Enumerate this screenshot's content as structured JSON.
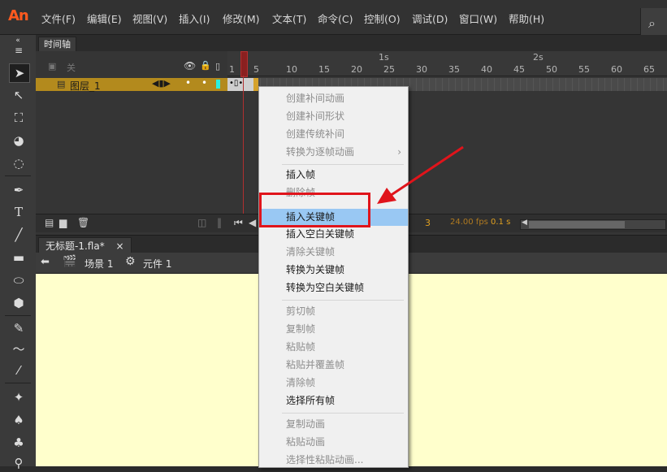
{
  "app": {
    "logo": "An"
  },
  "menubar": {
    "items": [
      "文件(F)",
      "编辑(E)",
      "视图(V)",
      "插入(I)",
      "修改(M)",
      "文本(T)",
      "命令(C)",
      "控制(O)",
      "调试(D)",
      "窗口(W)",
      "帮助(H)"
    ]
  },
  "timeline": {
    "tab_label": "时间轴",
    "header_label": "关",
    "layer_name": "图层_1",
    "ruler_ticks": [
      "1",
      "5",
      "10",
      "15",
      "20",
      "25",
      "30",
      "35",
      "40",
      "45",
      "50",
      "55",
      "60",
      "65"
    ],
    "seconds": [
      "1s",
      "2s"
    ],
    "current_frame": "3",
    "fps": "24.00 fps",
    "time": "0.1 s"
  },
  "document": {
    "tab_label": "无标题-1.fla*",
    "close_glyph": "×",
    "scene_label": "场景 1",
    "symbol_label": "元件 1"
  },
  "context_menu": {
    "items": [
      {
        "label": "创建补间动画",
        "disabled": true
      },
      {
        "label": "创建补间形状",
        "disabled": true
      },
      {
        "label": "创建传统补间",
        "disabled": true
      },
      {
        "label": "转换为逐帧动画",
        "disabled": true,
        "submenu": true
      },
      {
        "label": "插入帧",
        "disabled": false
      },
      {
        "label": "删除帧",
        "disabled": true
      },
      {
        "label": "插入关键帧",
        "disabled": false,
        "highlighted": true
      },
      {
        "label": "插入空白关键帧",
        "disabled": false
      },
      {
        "label": "清除关键帧",
        "disabled": true
      },
      {
        "label": "转换为关键帧",
        "disabled": false
      },
      {
        "label": "转换为空白关键帧",
        "disabled": false
      },
      {
        "label": "剪切帧",
        "disabled": true
      },
      {
        "label": "复制帧",
        "disabled": true
      },
      {
        "label": "粘贴帧",
        "disabled": true
      },
      {
        "label": "粘贴并覆盖帧",
        "disabled": true
      },
      {
        "label": "清除帧",
        "disabled": true
      },
      {
        "label": "选择所有帧",
        "disabled": false
      },
      {
        "label": "复制动画",
        "disabled": true
      },
      {
        "label": "粘贴动画",
        "disabled": true
      },
      {
        "label": "选择性粘贴动画...",
        "disabled": true
      }
    ],
    "submenu_glyph": "›"
  },
  "colors": {
    "accent": "#e0141b",
    "highlight": "#99c8f3",
    "stage": "#ffffcc",
    "layer": "#b38a1d"
  }
}
